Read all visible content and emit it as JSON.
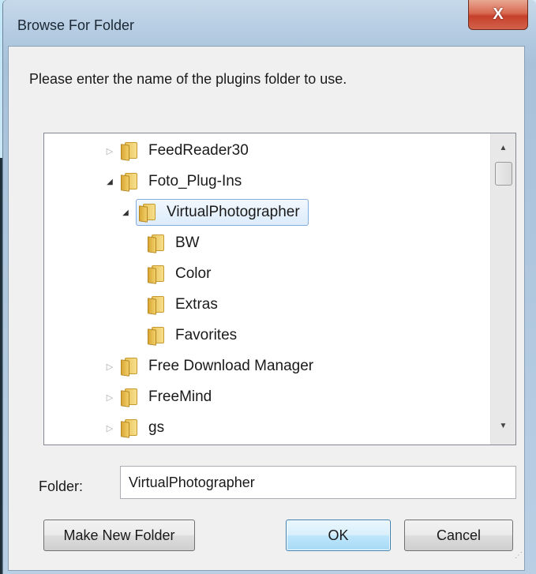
{
  "window": {
    "title": "Browse For Folder",
    "close_glyph": "X"
  },
  "dialog": {
    "prompt": "Please enter the name of the plugins folder to use."
  },
  "tree": {
    "items": [
      {
        "label": "FeedReader30",
        "expander": "▷",
        "state": "collapsed"
      },
      {
        "label": "Foto_Plug-Ins",
        "expander": "◢",
        "state": "expanded"
      },
      {
        "label": "VirtualPhotographer",
        "expander": "◢",
        "state": "expanded",
        "selected": true
      },
      {
        "label": "BW"
      },
      {
        "label": "Color"
      },
      {
        "label": "Extras"
      },
      {
        "label": "Favorites"
      },
      {
        "label": "Free Download Manager",
        "expander": "▷",
        "state": "collapsed"
      },
      {
        "label": "FreeMind",
        "expander": "▷",
        "state": "collapsed"
      },
      {
        "label": "gs",
        "expander": "▷",
        "state": "collapsed"
      }
    ],
    "scroll_up_glyph": "▲",
    "scroll_down_glyph": "▼"
  },
  "folder_field": {
    "label": "Folder:",
    "value": "VirtualPhotographer"
  },
  "buttons": {
    "make_new_folder": "Make New Folder",
    "ok": "OK",
    "cancel": "Cancel"
  },
  "icons": {
    "folder": "folder-icon",
    "close": "close-icon",
    "expand": "expand-arrow-icon",
    "collapse": "collapse-arrow-icon",
    "resize": "resize-grip-icon"
  },
  "colors": {
    "selection_border": "#84acdd",
    "selection_fill": "#dcebfc",
    "close_button": "#c6402a",
    "default_button_border": "#3c7fb1"
  }
}
